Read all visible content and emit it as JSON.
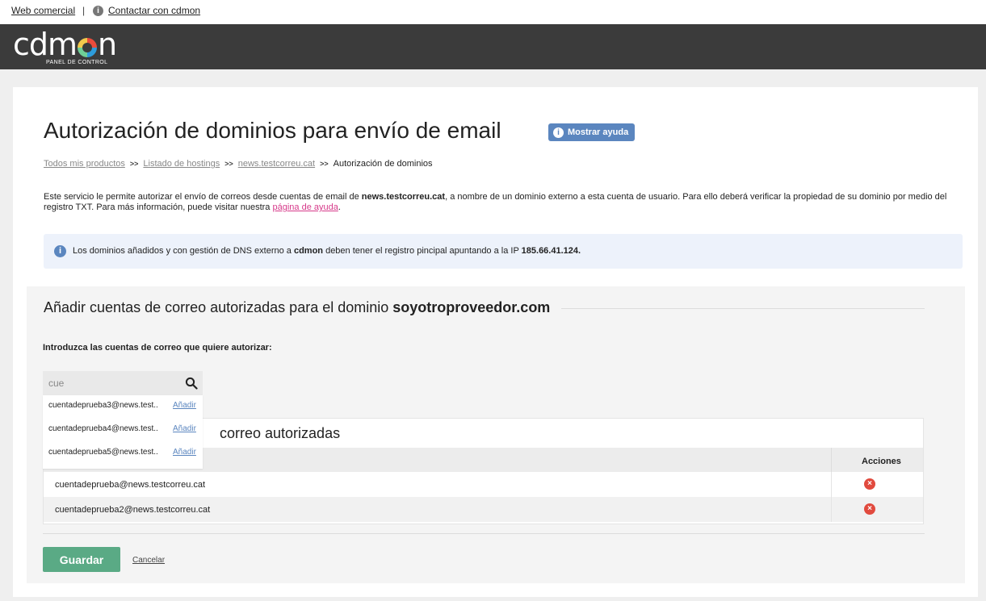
{
  "topbar": {
    "web_comercial": "Web comercial",
    "separator": "|",
    "contactar": "Contactar con cdmon"
  },
  "brand": {
    "logo_pre": "cdm",
    "logo_post": "n",
    "subtitle": "PANEL DE CONTROL"
  },
  "page": {
    "title": "Autorización de dominios para envío de email",
    "help_button": "Mostrar ayuda"
  },
  "breadcrumb": {
    "items": [
      "Todos mis productos",
      "Listado de hostings",
      "news.testcorreu.cat"
    ],
    "current": "Autorización de dominios",
    "separator": ">>"
  },
  "description": {
    "part1": "Este servicio le permite autorizar el envío de correos desde cuentas de email de ",
    "domain": "news.testcorreu.cat",
    "part2": ", a nombre de un dominio externo a esta cuenta de usuario. Para ello deberá verificar la propiedad de su dominio por medio del registro TXT. Para más información, puede visitar nuestra ",
    "help_link": "página de ayuda",
    "part3": "."
  },
  "notice": {
    "part1": "Los dominios añadidos y con gestión de DNS externo a ",
    "brand": "cdmon",
    "part2": " deben tener el registro pincipal apuntando a la IP ",
    "ip": "185.66.41.124."
  },
  "section": {
    "title_prefix": "Añadir cuentas de correo autorizadas para el dominio ",
    "domain": "soyotroproveedor.com",
    "intro": "Introduzca las cuentas de correo que quiere autorizar:",
    "search": {
      "value": "cue",
      "placeholder": ""
    },
    "suggestions": [
      {
        "address": "cuentadeprueba3@news.test..",
        "action": "Añadir"
      },
      {
        "address": "cuentadeprueba4@news.test..",
        "action": "Añadir"
      },
      {
        "address": "cuentadeprueba5@news.test..",
        "action": "Añadir"
      }
    ],
    "authorized_title": "correo autorizadas",
    "table": {
      "actions_header": "Acciones",
      "rows": [
        {
          "email": "cuentadeprueba@news.testcorreu.cat"
        },
        {
          "email": "cuentadeprueba2@news.testcorreu.cat"
        }
      ]
    },
    "save": "Guardar",
    "cancel": "Cancelar"
  },
  "colors": {
    "topbar_dark": "#3b3b3b",
    "accent_blue": "#5b86bf",
    "save_green": "#5aaa85",
    "delete_red": "#e14a3e",
    "link_pink": "#d63a8a"
  },
  "icons": {
    "info": "info-icon",
    "search": "search-icon",
    "delete": "delete-icon"
  }
}
